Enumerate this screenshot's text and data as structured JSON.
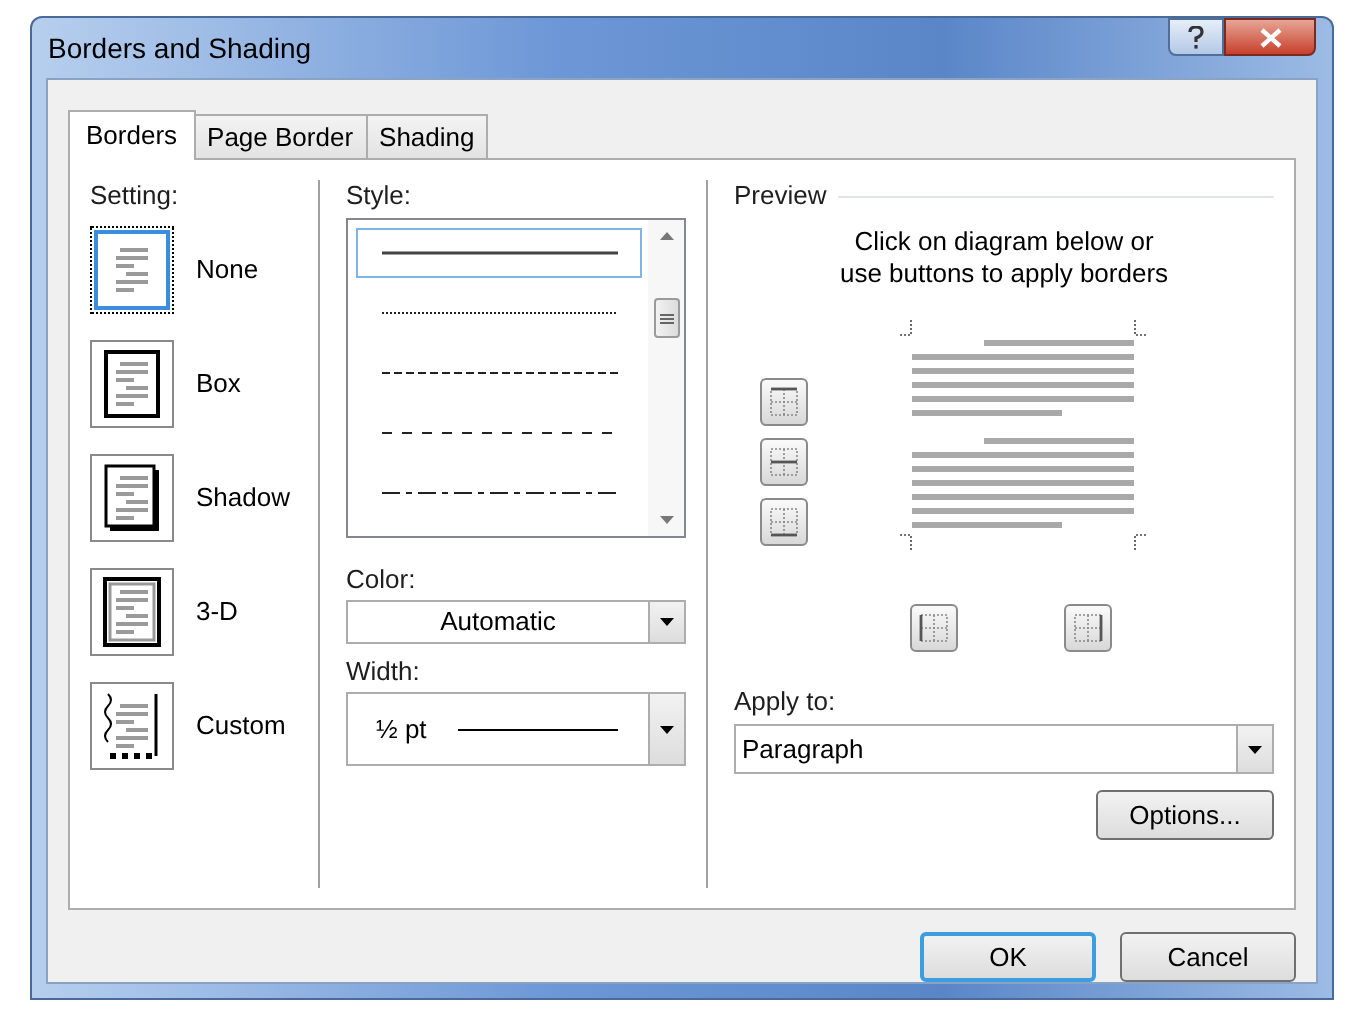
{
  "window": {
    "title": "Borders and Shading"
  },
  "tabs": [
    {
      "label": "Borders",
      "selected": true
    },
    {
      "label": "Page Border",
      "selected": false
    },
    {
      "label": "Shading",
      "selected": false
    }
  ],
  "setting": {
    "label": "Setting:",
    "items": [
      {
        "label": "None",
        "kind": "none",
        "selected": true
      },
      {
        "label": "Box",
        "kind": "box",
        "selected": false
      },
      {
        "label": "Shadow",
        "kind": "shadow",
        "selected": false
      },
      {
        "label": "3-D",
        "kind": "threed",
        "selected": false
      },
      {
        "label": "Custom",
        "kind": "custom",
        "selected": false
      }
    ]
  },
  "style": {
    "label": "Style:",
    "options": [
      {
        "kind": "solid",
        "selected": true
      },
      {
        "kind": "dotted",
        "selected": false
      },
      {
        "kind": "dashed",
        "selected": false
      },
      {
        "kind": "wide-dashed",
        "selected": false
      },
      {
        "kind": "dash-dot",
        "selected": false
      }
    ]
  },
  "color": {
    "label": "Color:",
    "value": "Automatic"
  },
  "width": {
    "label": "Width:",
    "value": "½ pt"
  },
  "preview": {
    "title": "Preview",
    "instructions": "Click on diagram below or\nuse buttons to apply borders"
  },
  "apply_to": {
    "label": "Apply to:",
    "value": "Paragraph"
  },
  "options_button": "Options...",
  "buttons": [
    {
      "label": "OK",
      "default": true
    },
    {
      "label": "Cancel",
      "default": false
    }
  ]
}
